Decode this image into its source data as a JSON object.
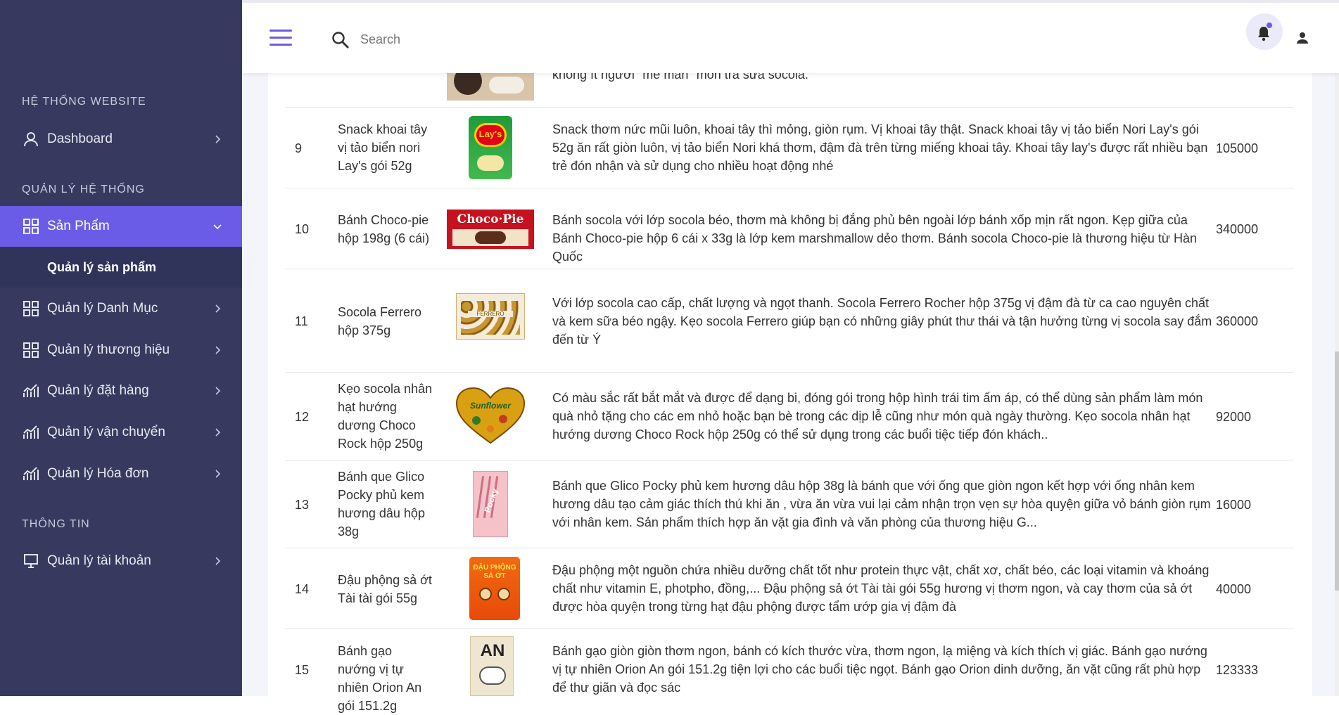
{
  "sidebar": {
    "sections": [
      "HỆ THỐNG WEBSITE",
      "QUẢN LÝ HỆ THỐNG",
      "THÔNG TIN"
    ],
    "items": [
      {
        "label": "Dashboard",
        "icon": "user-icon"
      },
      {
        "label": "Sản Phẩm",
        "icon": "grid-icon",
        "active": true
      },
      {
        "label": "Quản lý Danh Mục",
        "icon": "grid-icon"
      },
      {
        "label": "Quản lý thương hiệu",
        "icon": "grid-icon"
      },
      {
        "label": "Quản lý đặt hàng",
        "icon": "chart-icon"
      },
      {
        "label": "Quản lý vận chuyển",
        "icon": "chart-icon"
      },
      {
        "label": "Quản lý Hóa đơn",
        "icon": "chart-icon"
      },
      {
        "label": "Quản lý tài khoản",
        "icon": "monitor-icon"
      }
    ],
    "subitem": "Quản lý sản phẩm"
  },
  "topbar": {
    "search_placeholder": "Search"
  },
  "colors": {
    "sidebar": "#373a5e",
    "accent": "#6a5ce6"
  },
  "table": {
    "partial_row_desc": "không ít người \"mê mẩn\" món trà sữa socola.",
    "rows": [
      {
        "id": "9",
        "name": "Snack khoai tây vị tảo biển nori Lay's gói 52g",
        "desc": "Snack thơm nức mũi luôn, khoai tây thì mỏng, giòn rụm. Vị khoai tây thật. Snack khoai tây vị tảo biển Nori Lay's gói 52g ăn rất giòn luôn, vị tảo biển Nori khá thơm, đậm đà trên từng miếng khoai tây. Khoai tây lay's được rất nhiều bạn trẻ đón nhận và sử dụng cho nhiều hoạt động nhé",
        "price": "105000",
        "img_label": "Lay's"
      },
      {
        "id": "10",
        "name": "Bánh Choco-pie hộp 198g (6 cái)",
        "desc": "Bánh socola với lớp socola béo, thơm mà không bị đắng phủ bên ngoài lớp bánh xốp mịn rất ngon. Kẹp giữa của Bánh Choco-pie hộp 6 cái x 33g là lớp kem marshmallow dẻo thơm. Bánh socola Choco-pie là thương hiệu từ Hàn Quốc",
        "price": "340000",
        "img_label": "Choco·Pie"
      },
      {
        "id": "11",
        "name": "Socola Ferrero hộp 375g",
        "desc": "Với lớp socola cao cấp, chất lượng và ngọt thanh. Socola Ferrero Rocher hộp 375g vị đậm đà từ ca cao nguyên chất và kem sữa béo ngậy. Kẹo socola Ferrero giúp bạn có những giây phút thư thái và tận hưởng từng vị socola say đắm đến từ Ý",
        "price": "360000",
        "img_label": "FERRERO"
      },
      {
        "id": "12",
        "name": "Kẹo socola nhân hạt hướng dương Choco Rock hộp 250g",
        "desc": "Có màu sắc rất bắt mắt và được để dạng bi, đóng gói trong hộp hình trái tim ấm áp, có thể dùng sản phẩm làm món quà nhỏ tặng cho các em nhỏ hoặc bạn bè trong các dịp lễ cũng như món quà ngày thường. Kẹo socola nhân hạt hướng dương Choco Rock hộp 250g có thể sử dụng trong các buổi tiệc tiếp đón khách..",
        "price": "92000",
        "img_label": "Sunflower"
      },
      {
        "id": "13",
        "name": "Bánh que Glico Pocky phủ kem hương dâu hộp 38g",
        "desc": "Bánh que Glico Pocky phủ kem hương dâu hộp 38g là bánh que với ống que giòn ngon kết hợp với ống nhân kem hương dâu tạo cảm giác thích thú khi ăn , vừa ăn vừa vui lại cảm nhận trọn vẹn sự hòa quyện giữa vỏ bánh giòn rụm với nhân kem. Sản phẩm thích hợp ăn vặt gia đình và văn phòng của thương hiệu G...",
        "price": "16000",
        "img_label": "Pocky"
      },
      {
        "id": "14",
        "name": "Đậu phộng sả ớt Tài tài gói 55g",
        "desc": "Đậu phộng một nguồn chứa nhiều dưỡng chất tốt như protein thực vật, chất xơ, chất béo, các loại vitamin và khoáng chất như vitamin E, photpho, đồng,... Đậu phộng sả ớt Tài tài gói 55g hương vị thơm ngon, và cay thơm của sả ớt được hòa quyện trong từng hạt đậu phộng được tẩm ướp gia vị đậm đà",
        "price": "40000",
        "img_label": "ĐẬU PHỘNG SẢ ỚT"
      },
      {
        "id": "15",
        "name": "Bánh gạo nướng vị tự nhiên Orion An gói 151.2g",
        "desc": "Bánh gạo giòn giòn thơm ngon, bánh có kích thước vừa, thơm ngon, lạ miệng và kích thích vị giác. Bánh gạo nướng vị tự nhiên Orion An gói 151.2g tiện lợi cho các buổi tiệc ngọt. Bánh gạo Orion dinh dưỡng, ăn vặt cũng rất phù hợp để thư giãn và đọc sác",
        "price": "123333",
        "img_label": "AN"
      }
    ]
  }
}
